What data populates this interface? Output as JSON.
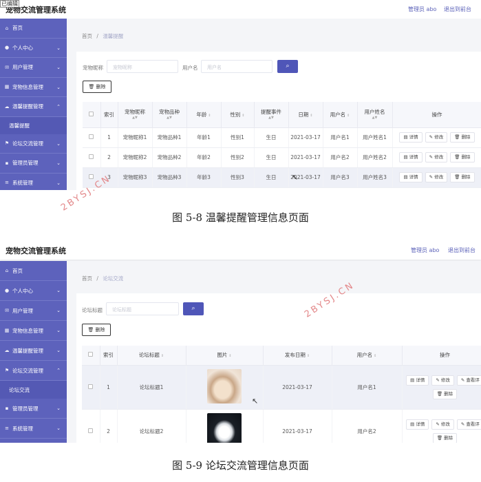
{
  "shot1": {
    "badge": "已编辑",
    "sys_title": "宠物交流管理系统",
    "admin": "管理员 abo",
    "logout": "退出到前台",
    "sidebar": [
      {
        "label": "首页",
        "icon": "home-icon",
        "glyph": "⌂",
        "chev": ""
      },
      {
        "label": "个人中心",
        "icon": "person-icon",
        "glyph": "●",
        "chev": "⌄"
      },
      {
        "label": "用户管理",
        "icon": "mail-icon",
        "glyph": "✉",
        "chev": "⌄"
      },
      {
        "label": "宠物信息管理",
        "icon": "layers-icon",
        "glyph": "▦",
        "chev": "⌄"
      },
      {
        "label": "温馨提醒管理",
        "icon": "cloud-icon",
        "glyph": "☁",
        "chev": "⌃"
      },
      {
        "label": "论坛交流管理",
        "icon": "flag-icon",
        "glyph": "⚑",
        "chev": "⌄"
      },
      {
        "label": "管理员管理",
        "icon": "grid-icon",
        "glyph": "▪",
        "chev": "⌄"
      },
      {
        "label": "系统管理",
        "icon": "list-icon",
        "glyph": "≡",
        "chev": "⌄"
      }
    ],
    "sub_item": "温馨提醒",
    "crumb_home": "首页",
    "crumb_sep": "/",
    "crumb_current": "温馨提醒",
    "search": [
      {
        "label": "宠物昵称",
        "placeholder": "宠物昵称"
      },
      {
        "label": "用户名",
        "placeholder": "用户名"
      }
    ],
    "search_icon": "⌕",
    "delete_label": "🗑 删除",
    "columns": [
      "索引",
      "宠物昵称",
      "宠物品种",
      "年龄",
      "性别",
      "提醒事件",
      "日期",
      "用户名",
      "用户姓名",
      "操作"
    ],
    "rows": [
      [
        "1",
        "宠物昵称1",
        "宠物品种1",
        "年龄1",
        "性别1",
        "生日",
        "2021-03-17",
        "用户名1",
        "用户姓名1"
      ],
      [
        "2",
        "宠物昵称2",
        "宠物品种2",
        "年龄2",
        "性别2",
        "生日",
        "2021-03-17",
        "用户名2",
        "用户姓名2"
      ],
      [
        "3",
        "宠物昵称3",
        "宠物品种3",
        "年龄3",
        "性别3",
        "生日",
        "2021-03-17",
        "用户名3",
        "用户姓名3"
      ]
    ],
    "ops": [
      "详情",
      "修改",
      "删除"
    ]
  },
  "caption1": "图 5-8 温馨提醒管理信息页面",
  "shot2": {
    "sys_title": "宠物交流管理系统",
    "admin": "管理员 abo",
    "logout": "退出到前台",
    "sidebar": [
      {
        "label": "首页",
        "icon": "home-icon",
        "glyph": "⌂",
        "chev": ""
      },
      {
        "label": "个人中心",
        "icon": "person-icon",
        "glyph": "●",
        "chev": "⌄"
      },
      {
        "label": "用户管理",
        "icon": "mail-icon",
        "glyph": "✉",
        "chev": "⌄"
      },
      {
        "label": "宠物信息管理",
        "icon": "layers-icon",
        "glyph": "▦",
        "chev": "⌄"
      },
      {
        "label": "温馨提醒管理",
        "icon": "cloud-icon",
        "glyph": "☁",
        "chev": "⌄"
      },
      {
        "label": "论坛交流管理",
        "icon": "flag-icon",
        "glyph": "⚑",
        "chev": "⌃"
      },
      {
        "label": "管理员管理",
        "icon": "grid-icon",
        "glyph": "▪",
        "chev": "⌄"
      },
      {
        "label": "系统管理",
        "icon": "list-icon",
        "glyph": "≡",
        "chev": "⌄"
      }
    ],
    "sub_item": "论坛交流",
    "crumb_home": "首页",
    "crumb_sep": "/",
    "crumb_current": "论坛交流",
    "search": [
      {
        "label": "论坛标题",
        "placeholder": "论坛标题"
      }
    ],
    "search_icon": "⌕",
    "delete_label": "🗑 删除",
    "columns": [
      "索引",
      "论坛标题",
      "图片",
      "发布日期",
      "用户名",
      "操作"
    ],
    "rows": [
      [
        "1",
        "论坛标题1",
        "",
        "2021-03-17",
        "用户名1"
      ],
      [
        "2",
        "论坛标题2",
        "",
        "2021-03-17",
        "用户名2"
      ]
    ],
    "ops": [
      "详情",
      "修改",
      "查看评",
      "删除"
    ]
  },
  "caption2": "图 5-9 论坛交流管理信息页面",
  "watermark": "2BYSJ.CN",
  "colors": {
    "sidebar": "#5d62bc",
    "accent": "#4f56b8",
    "watermark": "#e3888a"
  }
}
